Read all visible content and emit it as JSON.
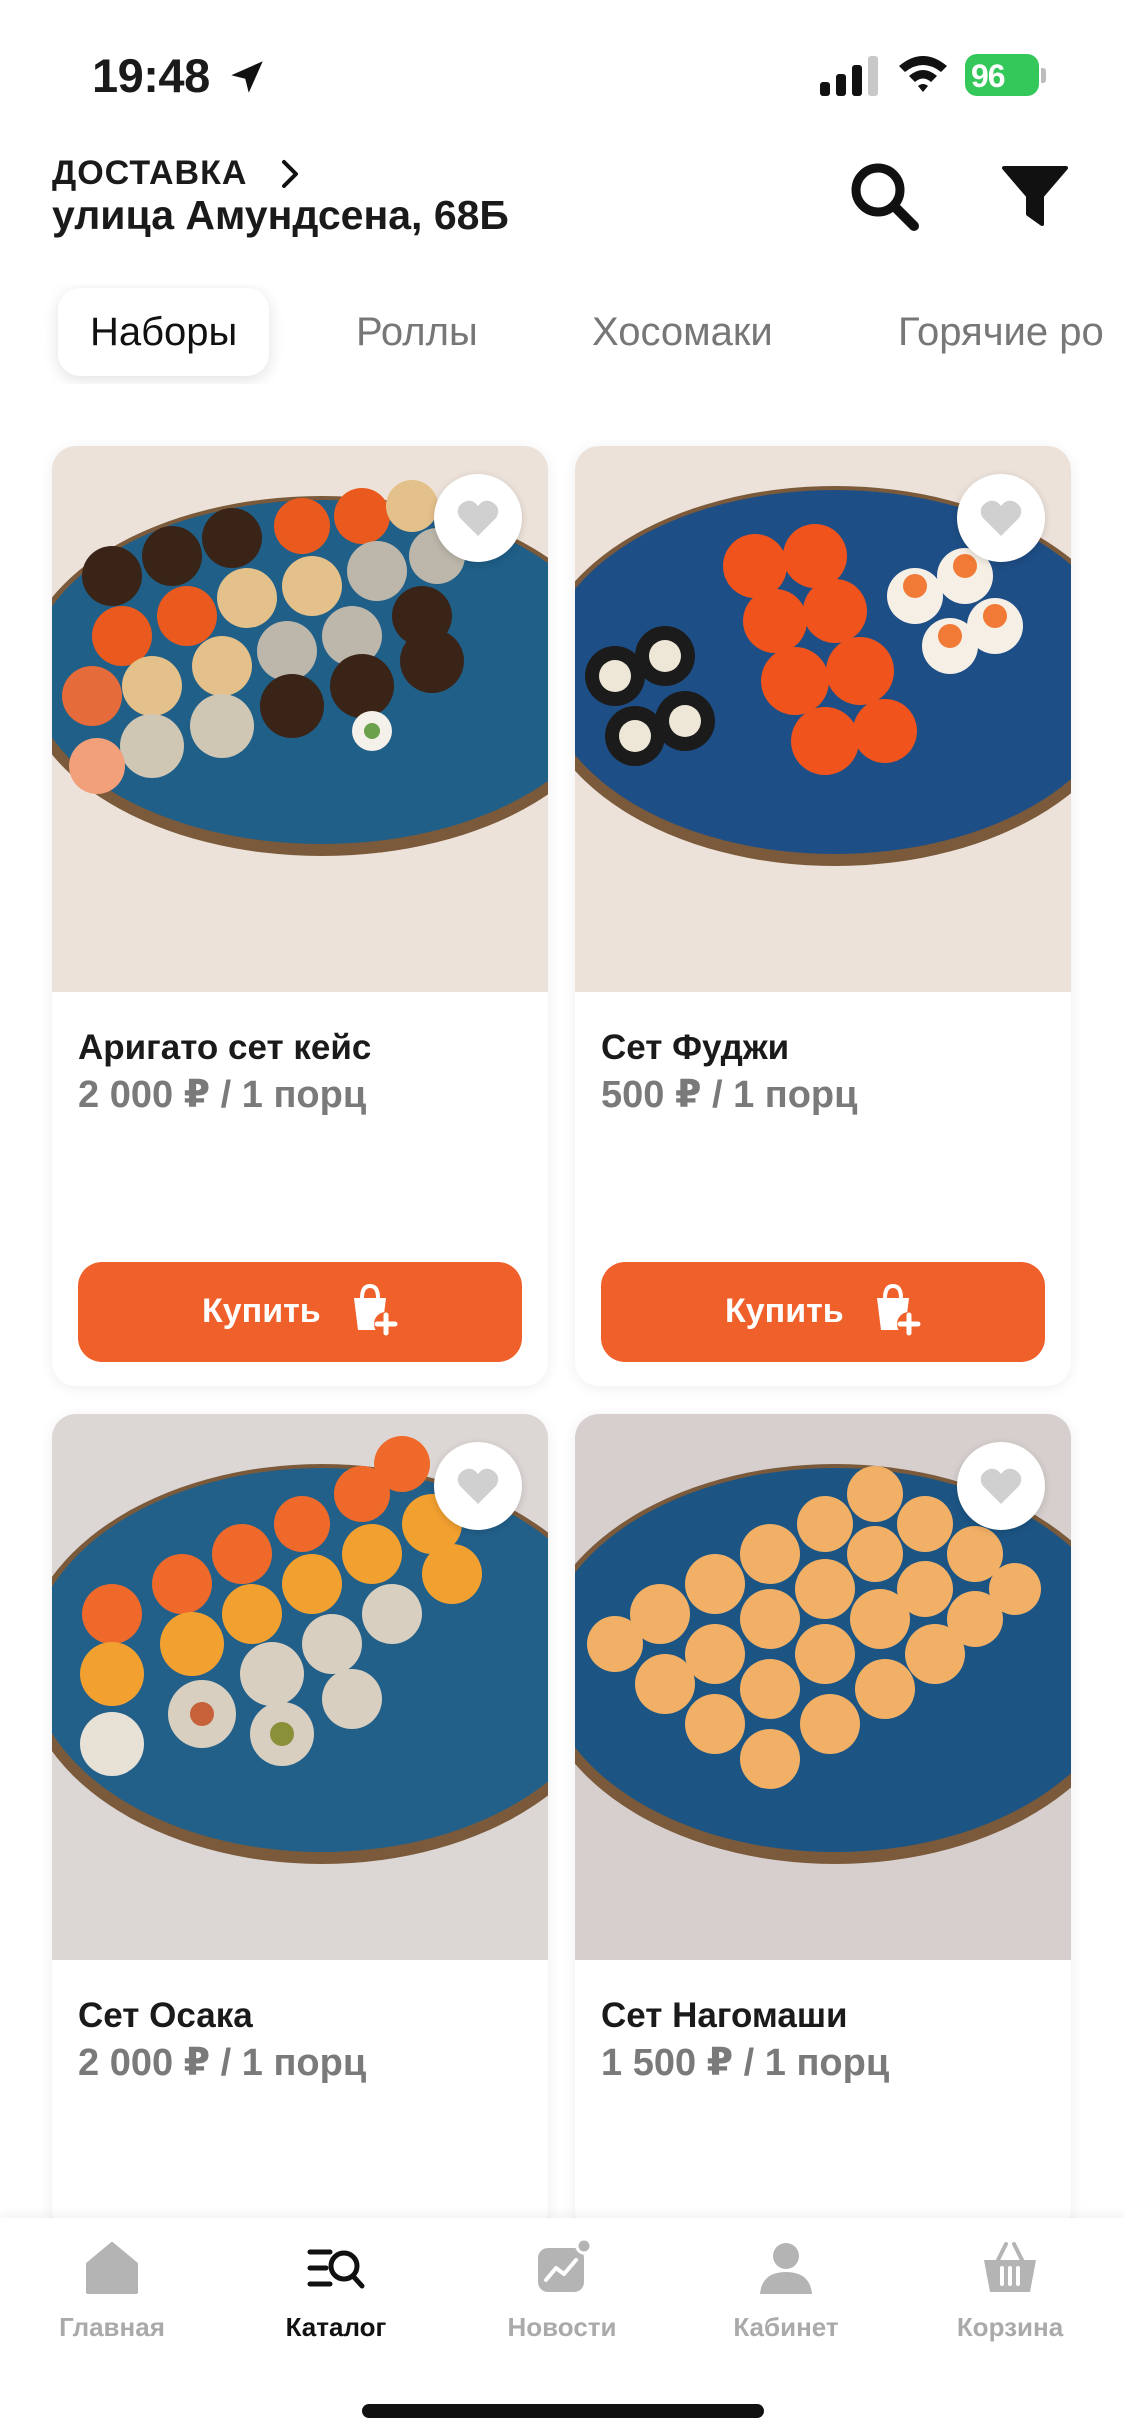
{
  "status": {
    "time": "19:48",
    "battery": "96"
  },
  "header": {
    "delivery_label": "ДОСТАВКА",
    "address": "улица Амундсена, 68Б"
  },
  "tabs": [
    {
      "label": "Наборы",
      "active": true
    },
    {
      "label": "Роллы",
      "active": false
    },
    {
      "label": "Хосомаки",
      "active": false
    },
    {
      "label": "Горячие ро",
      "active": false
    }
  ],
  "products": [
    {
      "title": "Аригато сет кейс",
      "price": "2 000 ₽ / 1 порц",
      "buy_label": "Купить"
    },
    {
      "title": "Сет Фуджи",
      "price": "500 ₽ / 1 порц",
      "buy_label": "Купить"
    },
    {
      "title": "Сет Осака",
      "price": "2 000 ₽ / 1 порц"
    },
    {
      "title": "Сет Нагомаши",
      "price": "1 500 ₽ / 1 порц"
    }
  ],
  "nav": [
    {
      "label": "Главная",
      "icon": "home-icon",
      "active": false
    },
    {
      "label": "Каталог",
      "icon": "catalog-icon",
      "active": true
    },
    {
      "label": "Новости",
      "icon": "news-icon",
      "active": false
    },
    {
      "label": "Кабинет",
      "icon": "profile-icon",
      "active": false
    },
    {
      "label": "Корзина",
      "icon": "basket-icon",
      "active": false
    }
  ],
  "colors": {
    "accent": "#f0602a",
    "battery": "#34c759",
    "plate": "#1c4f7a"
  }
}
